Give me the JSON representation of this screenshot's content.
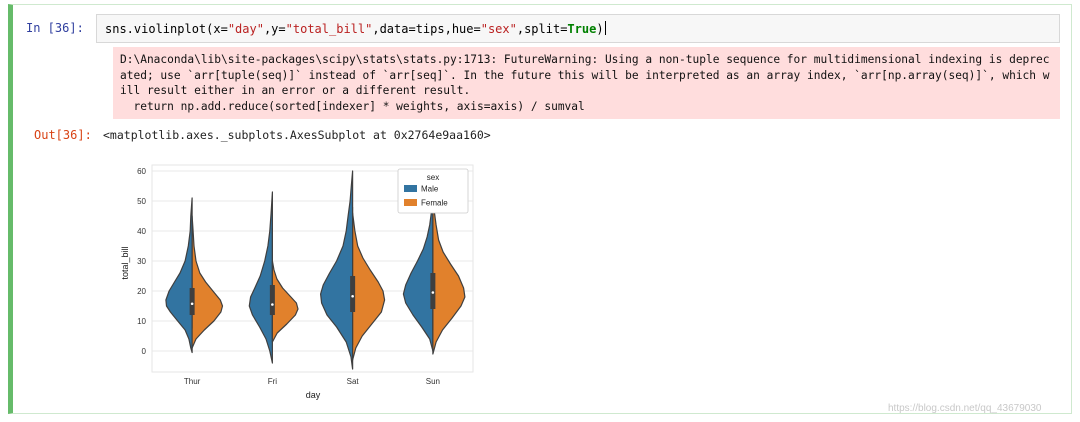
{
  "cell": {
    "in_prompt": "In  [36]:",
    "code": {
      "p1": "sns.violinplot(x=",
      "s1": "\"day\"",
      "p2": ",y=",
      "s2": "\"total_bill\"",
      "p3": ",data=tips,hue=",
      "s3": "\"sex\"",
      "p4": ",split=",
      "kw": "True",
      "p5": ")"
    },
    "stderr": "D:\\Anaconda\\lib\\site-packages\\scipy\\stats\\stats.py:1713: FutureWarning: Using a non-tuple sequence for multidimensional indexing is deprecated; use `arr[tuple(seq)]` instead of `arr[seq]`. In the future this will be interpreted as an array index, `arr[np.array(seq)]`, which will result either in an error or a different result.\n  return np.add.reduce(sorted[indexer] * weights, axis=axis) / sumval",
    "out_prompt": "Out[36]:",
    "out_text": "<matplotlib.axes._subplots.AxesSubplot at 0x2764e9aa160>"
  },
  "watermark": "https://blog.csdn.net/qq_43679030",
  "chart_data": {
    "type": "violin",
    "xlabel": "day",
    "ylabel": "total_bill",
    "categories": [
      "Thur",
      "Fri",
      "Sat",
      "Sun"
    ],
    "ylim": [
      -7,
      62
    ],
    "yticks": [
      "0",
      "10",
      "20",
      "30",
      "40",
      "50",
      "60"
    ],
    "grid": true,
    "legend": {
      "title": "sex",
      "position": "top-right"
    },
    "series": [
      {
        "name": "Male",
        "color": "#3274a1",
        "violins": [
          {
            "min": -0.5,
            "max": 51,
            "q1": 13,
            "median": 16.5,
            "q3": 21,
            "profile": [
              [
                -0.5,
                0
              ],
              [
                1,
                0.04
              ],
              [
                4,
                0.1
              ],
              [
                7,
                0.22
              ],
              [
                10,
                0.45
              ],
              [
                13,
                0.68
              ],
              [
                15,
                0.8
              ],
              [
                17,
                0.82
              ],
              [
                20,
                0.72
              ],
              [
                23,
                0.55
              ],
              [
                26,
                0.38
              ],
              [
                30,
                0.22
              ],
              [
                35,
                0.12
              ],
              [
                40,
                0.06
              ],
              [
                45,
                0.04
              ],
              [
                51,
                0
              ]
            ]
          },
          {
            "min": -4,
            "max": 53,
            "q1": 12,
            "median": 16,
            "q3": 22,
            "profile": [
              [
                -4,
                0
              ],
              [
                0,
                0.08
              ],
              [
                4,
                0.2
              ],
              [
                8,
                0.4
              ],
              [
                12,
                0.62
              ],
              [
                15,
                0.72
              ],
              [
                18,
                0.68
              ],
              [
                21,
                0.55
              ],
              [
                25,
                0.38
              ],
              [
                30,
                0.24
              ],
              [
                35,
                0.14
              ],
              [
                40,
                0.08
              ],
              [
                46,
                0.04
              ],
              [
                53,
                0
              ]
            ]
          },
          {
            "min": -6,
            "max": 60,
            "q1": 13,
            "median": 18.5,
            "q3": 25,
            "profile": [
              [
                -6,
                0
              ],
              [
                -2,
                0.05
              ],
              [
                3,
                0.2
              ],
              [
                8,
                0.5
              ],
              [
                12,
                0.8
              ],
              [
                16,
                0.97
              ],
              [
                19,
                1.0
              ],
              [
                22,
                0.92
              ],
              [
                26,
                0.72
              ],
              [
                30,
                0.5
              ],
              [
                35,
                0.3
              ],
              [
                40,
                0.2
              ],
              [
                45,
                0.14
              ],
              [
                50,
                0.08
              ],
              [
                55,
                0.04
              ],
              [
                60,
                0
              ]
            ]
          },
          {
            "min": 0,
            "max": 49,
            "q1": 14,
            "median": 20,
            "q3": 26,
            "profile": [
              [
                0,
                0
              ],
              [
                4,
                0.1
              ],
              [
                8,
                0.35
              ],
              [
                12,
                0.62
              ],
              [
                16,
                0.85
              ],
              [
                19,
                0.92
              ],
              [
                22,
                0.85
              ],
              [
                26,
                0.68
              ],
              [
                30,
                0.48
              ],
              [
                34,
                0.3
              ],
              [
                38,
                0.18
              ],
              [
                42,
                0.1
              ],
              [
                46,
                0.05
              ],
              [
                49,
                0
              ]
            ]
          }
        ]
      },
      {
        "name": "Female",
        "color": "#e1812c",
        "violins": [
          {
            "min": 1,
            "max": 45,
            "q1": 12,
            "median": 15,
            "q3": 20,
            "profile": [
              [
                1,
                0
              ],
              [
                4,
                0.12
              ],
              [
                7,
                0.38
              ],
              [
                10,
                0.68
              ],
              [
                13,
                0.9
              ],
              [
                15,
                0.95
              ],
              [
                17,
                0.88
              ],
              [
                20,
                0.65
              ],
              [
                23,
                0.42
              ],
              [
                26,
                0.24
              ],
              [
                30,
                0.12
              ],
              [
                35,
                0.06
              ],
              [
                40,
                0.03
              ],
              [
                45,
                0
              ]
            ]
          },
          {
            "min": 3,
            "max": 30,
            "q1": 12,
            "median": 15,
            "q3": 18,
            "profile": [
              [
                3,
                0
              ],
              [
                6,
                0.15
              ],
              [
                9,
                0.45
              ],
              [
                12,
                0.72
              ],
              [
                14,
                0.8
              ],
              [
                16,
                0.75
              ],
              [
                18,
                0.58
              ],
              [
                21,
                0.32
              ],
              [
                24,
                0.14
              ],
              [
                27,
                0.05
              ],
              [
                30,
                0
              ]
            ]
          },
          {
            "min": -3,
            "max": 46,
            "q1": 13,
            "median": 18,
            "q3": 24,
            "profile": [
              [
                -3,
                0
              ],
              [
                1,
                0.1
              ],
              [
                5,
                0.3
              ],
              [
                9,
                0.6
              ],
              [
                13,
                0.9
              ],
              [
                17,
                1.0
              ],
              [
                20,
                0.95
              ],
              [
                23,
                0.8
              ],
              [
                27,
                0.55
              ],
              [
                31,
                0.32
              ],
              [
                35,
                0.16
              ],
              [
                40,
                0.07
              ],
              [
                46,
                0
              ]
            ]
          },
          {
            "min": -1,
            "max": 50,
            "q1": 14,
            "median": 19,
            "q3": 26,
            "profile": [
              [
                -1,
                0
              ],
              [
                3,
                0.1
              ],
              [
                7,
                0.3
              ],
              [
                11,
                0.6
              ],
              [
                15,
                0.88
              ],
              [
                18,
                1.0
              ],
              [
                21,
                0.96
              ],
              [
                25,
                0.8
              ],
              [
                29,
                0.55
              ],
              [
                33,
                0.32
              ],
              [
                37,
                0.18
              ],
              [
                42,
                0.1
              ],
              [
                46,
                0.05
              ],
              [
                50,
                0
              ]
            ]
          }
        ]
      }
    ]
  }
}
